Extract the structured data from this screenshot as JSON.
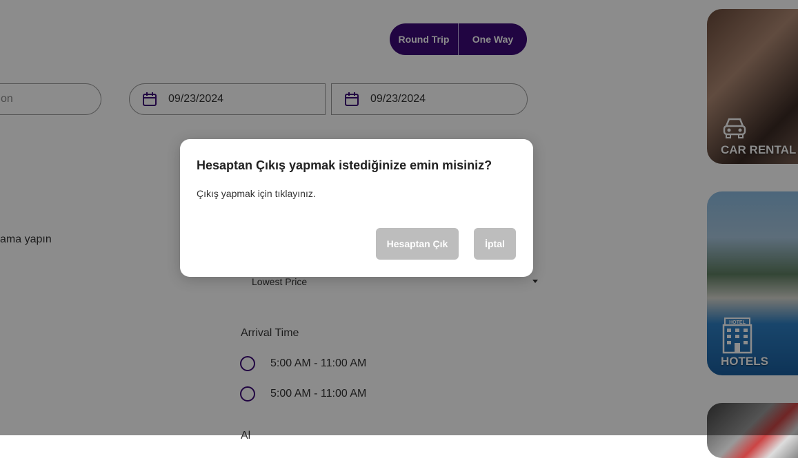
{
  "trip_toggle": {
    "round_trip": "Round Trip",
    "one_way": "One Way"
  },
  "search": {
    "destination_partial": "on",
    "depart_date": "09/23/2024",
    "return_date": "09/23/2024"
  },
  "filters": {
    "left_partial_text": "ama yapın",
    "sort_value": "Lowest Price",
    "arrival_title": "Arrival Time",
    "arrival_options": [
      "5:00 AM - 11:00 AM",
      "5:00 AM - 11:00 AM"
    ],
    "next_section_partial": "Al"
  },
  "side_cards": [
    {
      "label": "CAR RENTAL",
      "icon": "car-icon"
    },
    {
      "label": "HOTELS",
      "icon": "hotel-icon"
    }
  ],
  "modal": {
    "title": "Hesaptan Çıkış yapmak istediğinize emin misiniz?",
    "message": "Çıkış yapmak için tıklayınız.",
    "confirm_label": "Hesaptan Çık",
    "cancel_label": "İptal"
  },
  "colors": {
    "brand_purple": "#3d0a78",
    "overlay": "rgba(0,0,0,0.45)",
    "disabled_button": "#bdbdbd"
  }
}
